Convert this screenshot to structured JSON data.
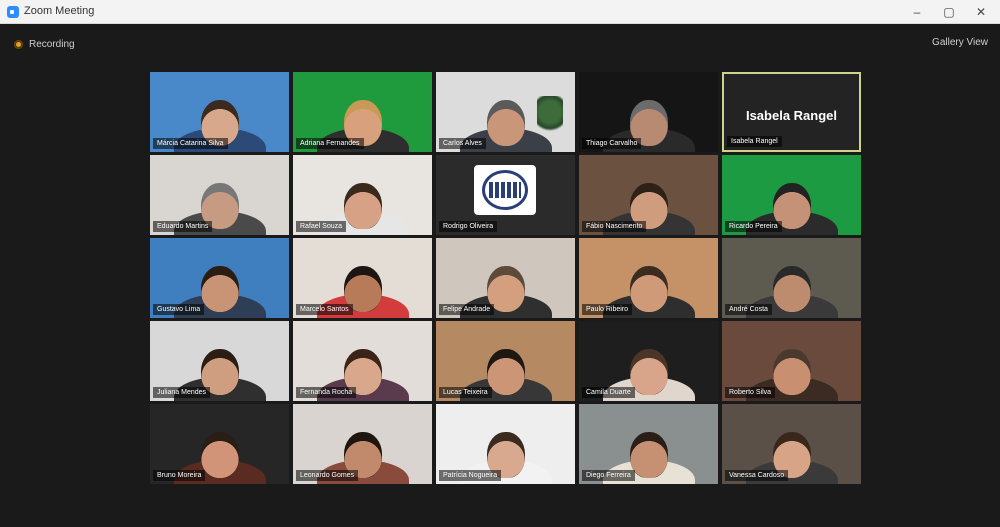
{
  "window": {
    "title": "Zoom Meeting"
  },
  "recording": {
    "label": "Recording"
  },
  "view": {
    "label": "Gallery View"
  },
  "active_speaker": "Isabela Rangel",
  "tiles": [
    {
      "name": "Márcia Catarina Silva",
      "bg": "#4a89c9",
      "skin": "#d8a88d",
      "shirt": "#2c4a78",
      "hair": "#3a2a20"
    },
    {
      "name": "Adriana Fernandes",
      "bg": "#1f9a3d",
      "skin": "#d9a07e",
      "shirt": "#2e2e2e",
      "hair": "#c89a55"
    },
    {
      "name": "Carlos Alves",
      "bg": "#dcdcdc",
      "skin": "#c9967a",
      "shirt": "#3b3f48",
      "hair": "#5a5a5a"
    },
    {
      "name": "Thiago Carvalho",
      "bg": "#151515",
      "skin": "#b98a72",
      "shirt": "#2a2a2a",
      "hair": "#6b6b6b"
    },
    {
      "name": "Isabela Rangel",
      "bg": "#232323",
      "special": "name",
      "label": "Isabela Rangel"
    },
    {
      "name": "Eduardo Martins",
      "bg": "#d9d6d2",
      "skin": "#c79a82",
      "shirt": "#4a4a4a",
      "hair": "#777"
    },
    {
      "name": "Rafael Souza",
      "bg": "#e8e4df",
      "skin": "#d6a184",
      "shirt": "#e6e6e6",
      "hair": "#3a2a1c"
    },
    {
      "name": "Rodrigo Oliveira",
      "bg": "#2b2b2b",
      "special": "logo"
    },
    {
      "name": "Fábio Nascimento",
      "bg": "#6b5240",
      "skin": "#cf9c7d",
      "shirt": "#343434",
      "hair": "#2d2118"
    },
    {
      "name": "Ricardo Pereira",
      "bg": "#1c9b43",
      "skin": "#c69277",
      "shirt": "#2b2b2b",
      "hair": "#222"
    },
    {
      "name": "Gustavo Lima",
      "bg": "#3f7fbf",
      "skin": "#c99376",
      "shirt": "#2d3e56",
      "hair": "#2a1d14"
    },
    {
      "name": "Marcelo Santos",
      "bg": "#e3ddd6",
      "skin": "#b87b5a",
      "shirt": "#d33c3c",
      "hair": "#1e1612"
    },
    {
      "name": "Felipe Andrade",
      "bg": "#cfc7be",
      "skin": "#d39f7e",
      "shirt": "#2f2f2f",
      "hair": "#5d4a3a"
    },
    {
      "name": "Paulo Ribeiro",
      "bg": "#c49266",
      "skin": "#cf9a78",
      "shirt": "#2e2e2e",
      "hair": "#3c2c20"
    },
    {
      "name": "André Costa",
      "bg": "#5d5a50",
      "skin": "#bd8b6e",
      "shirt": "#3a3a3a",
      "hair": "#2a2a2a"
    },
    {
      "name": "Juliana Mendes",
      "bg": "#d8d8d8",
      "skin": "#cf9d80",
      "shirt": "#2f2f2f",
      "hair": "#2b1d14"
    },
    {
      "name": "Fernanda Rocha",
      "bg": "#e2ddd8",
      "skin": "#d9a88c",
      "shirt": "#5a3b4d",
      "hair": "#3a2418"
    },
    {
      "name": "Lucas Teixeira",
      "bg": "#b58a62",
      "skin": "#cc9676",
      "shirt": "#373737",
      "hair": "#1f1712"
    },
    {
      "name": "Camila Duarte",
      "bg": "#1e1e1e",
      "skin": "#d9a58a",
      "shirt": "#e0d6cd",
      "hair": "#4a3526"
    },
    {
      "name": "Roberto Silva",
      "bg": "#6a4a3c",
      "skin": "#c98f71",
      "shirt": "#3b2b22",
      "hair": "#4a3a2e"
    },
    {
      "name": "Bruno Moreira",
      "bg": "#262626",
      "skin": "#d19478",
      "shirt": "#5a2b20",
      "hair": "#2a1d16"
    },
    {
      "name": "Leonardo Gomes",
      "bg": "#d9d4cf",
      "skin": "#c28a6c",
      "shirt": "#8a4b3c",
      "hair": "#1e1410"
    },
    {
      "name": "Patrícia Nogueira",
      "bg": "#eeeeee",
      "skin": "#d8a98e",
      "shirt": "#f2f2f2",
      "hair": "#3b2a20"
    },
    {
      "name": "Diego Ferreira",
      "bg": "#8a8f8f",
      "skin": "#c69073",
      "shirt": "#e8e2d6",
      "hair": "#2a1f18"
    },
    {
      "name": "Vanessa Cardoso",
      "bg": "#5a5048",
      "skin": "#d7a487",
      "shirt": "#3a3a3a",
      "hair": "#3a271b"
    }
  ]
}
